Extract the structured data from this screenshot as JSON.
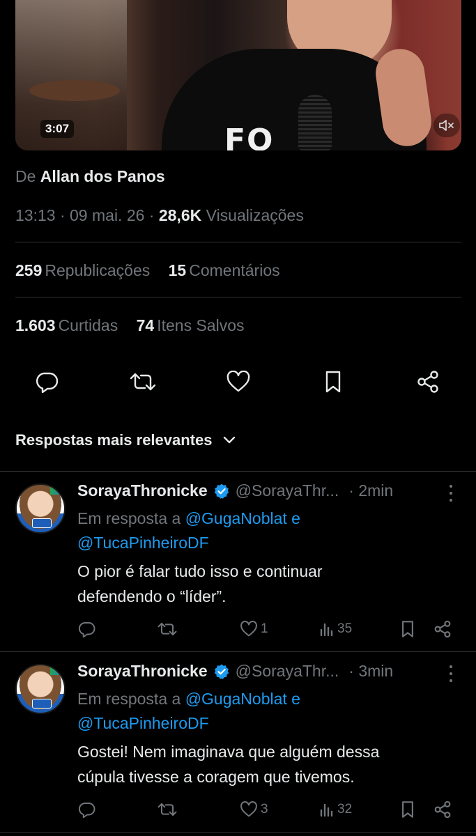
{
  "video": {
    "duration": "3:07",
    "shirt_text": "FO",
    "mute_icon": "volume-mute-icon"
  },
  "tweet": {
    "from_prefix": "De",
    "from_name": "Allan dos Panos",
    "time": "13:13",
    "sep1": " · ",
    "date": "09 mai. 26",
    "sep2": " · ",
    "views_count": "28,6K",
    "views_label": "Visualizações",
    "reposts_count": "259",
    "reposts_label": "Republicações",
    "comments_count": "15",
    "comments_label": "Comentários",
    "likes_count": "1.603",
    "likes_label": "Curtidas",
    "saves_count": "74",
    "saves_label": "Itens Salvos"
  },
  "actions": [
    "reply-icon",
    "repost-icon",
    "like-icon",
    "bookmark-icon",
    "share-icon"
  ],
  "sort": {
    "label": "Respostas mais relevantes"
  },
  "replies": [
    {
      "name": "SorayaThronicke",
      "handle": "@SorayaThr...",
      "time": "· 2min",
      "in_reply_prefix": "Em resposta a",
      "mention1": "@GugaNoblat e",
      "mention2": "@TucaPinheiroDF",
      "line1": "O pior é falar tudo isso e continuar",
      "line2": "defendendo o “líder”.",
      "likes": "1",
      "views": "35"
    },
    {
      "name": "SorayaThronicke",
      "handle": "@SorayaThr...",
      "time": "· 3min",
      "in_reply_prefix": "Em resposta a",
      "mention1": "@GugaNoblat e",
      "mention2": "@TucaPinheiroDF",
      "line1": "Gostei! Nem imaginava que alguém dessa",
      "line2": "cúpula tivesse a coragem que tivemos.",
      "likes": "3",
      "views": "32"
    }
  ],
  "colors": {
    "background": "#000000",
    "text": "#e7e9ea",
    "muted": "#71767b",
    "link": "#1d9bf0",
    "divider": "#2f3336",
    "verified": "#1d9bf0"
  }
}
